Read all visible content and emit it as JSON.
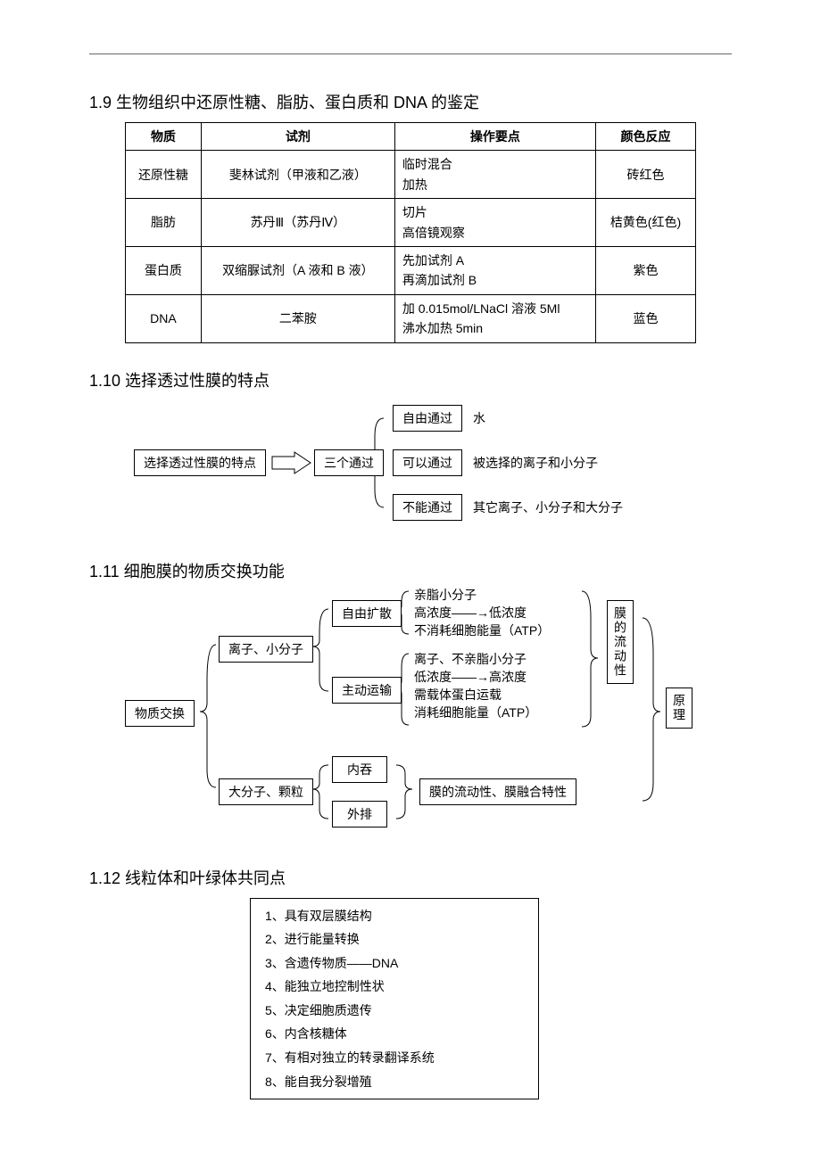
{
  "sec19": {
    "heading": "1.9 生物组织中还原性糖、脂肪、蛋白质和 DNA 的鉴定",
    "headers": [
      "物质",
      "试剂",
      "操作要点",
      "颜色反应"
    ],
    "rows": [
      {
        "c0": "还原性糖",
        "c1": "斐林试剂（甲液和乙液）",
        "c2": "临时混合\n加热",
        "c3": "砖红色"
      },
      {
        "c0": "脂肪",
        "c1": "苏丹Ⅲ（苏丹Ⅳ）",
        "c2": "切片\n高倍镜观察",
        "c3": "桔黄色(红色)"
      },
      {
        "c0": "蛋白质",
        "c1": "双缩脲试剂（A 液和 B 液）",
        "c2": "先加试剂 A\n再滴加试剂 B",
        "c3": "紫色"
      },
      {
        "c0": "DNA",
        "c1": "二苯胺",
        "c2": "加 0.015mol/LNaCl 溶液 5Ml\n沸水加热 5min",
        "c3": "蓝色"
      }
    ]
  },
  "sec110": {
    "heading": "1.10 选择透过性膜的特点",
    "root": "选择透过性膜的特点",
    "mid": "三个通过",
    "items": [
      {
        "box": "自由通过",
        "label": "水"
      },
      {
        "box": "可以通过",
        "label": "被选择的离子和小分子"
      },
      {
        "box": "不能通过",
        "label": "其它离子、小分子和大分子"
      }
    ]
  },
  "sec111": {
    "heading": "1.11 细胞膜的物质交换功能",
    "root": "物质交换",
    "b1": "离子、小分子",
    "b2": "大分子、颗粒",
    "c1": "自由扩散",
    "c2": "主动运输",
    "c3": "内吞",
    "c4": "外排",
    "d1a": "亲脂小分子",
    "d1b": "高浓度——→低浓度",
    "d1c": "不消耗细胞能量（ATP）",
    "d2a": "离子、不亲脂小分子",
    "d2b": "低浓度——→高浓度",
    "d2c": "需载体蛋白运载",
    "d2d": "消耗细胞能量（ATP）",
    "d3": "膜的流动性、膜融合特性",
    "side1": "膜的流动性",
    "side2": "原理"
  },
  "sec112": {
    "heading": "1.12 线粒体和叶绿体共同点",
    "items": [
      "1、具有双层膜结构",
      "2、进行能量转换",
      "3、含遗传物质——DNA",
      "4、能独立地控制性状",
      "5、决定细胞质遗传",
      "6、内含核糖体",
      "7、有相对独立的转录翻译系统",
      "8、能自我分裂增殖"
    ]
  }
}
